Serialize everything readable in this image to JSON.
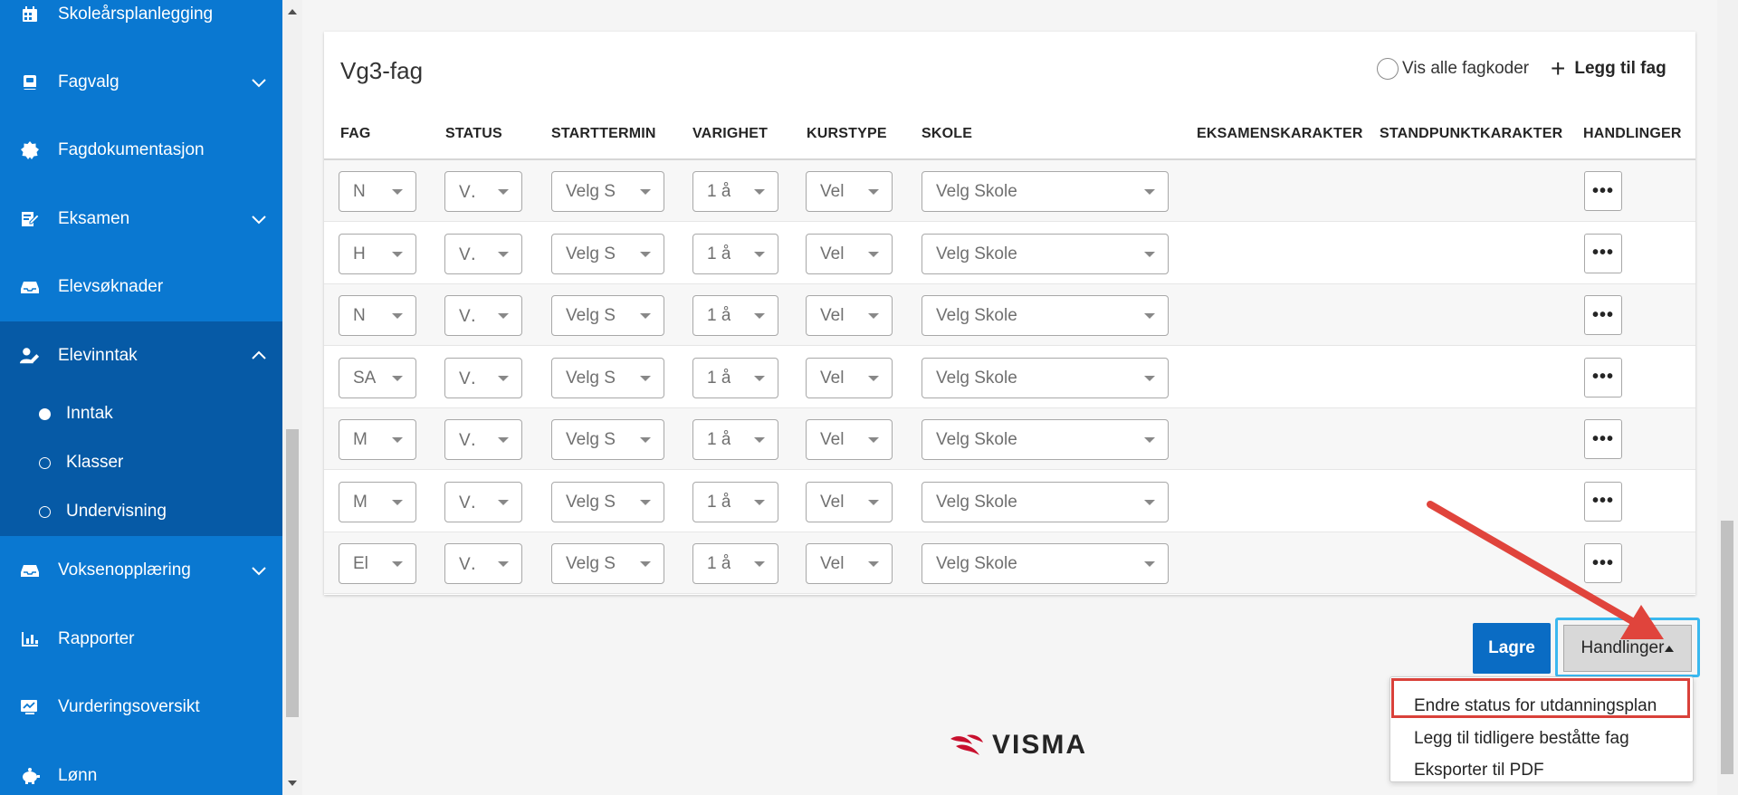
{
  "sidebar": {
    "items": [
      {
        "label": "Skoleårsplanlegging",
        "icon": "calendar-icon"
      },
      {
        "label": "Fagvalg",
        "icon": "book-icon"
      },
      {
        "label": "Fagdokumentasjon",
        "icon": "seal-icon"
      },
      {
        "label": "Eksamen",
        "icon": "edit-doc-icon"
      },
      {
        "label": "Elevsøknader",
        "icon": "inbox-icon"
      },
      {
        "label": "Elevinntak",
        "icon": "user-edit-icon"
      },
      {
        "label": "Voksenopplæring",
        "icon": "inbox-icon"
      },
      {
        "label": "Rapporter",
        "icon": "bar-chart-icon"
      },
      {
        "label": "Vurderingsoversikt",
        "icon": "chart-doc-icon"
      },
      {
        "label": "Lønn",
        "icon": "piggy-bank-icon"
      }
    ],
    "subitems": [
      {
        "label": "Inntak"
      },
      {
        "label": "Klasser"
      },
      {
        "label": "Undervisning"
      }
    ]
  },
  "card": {
    "title": "Vg3-fag",
    "show_codes_label": "Vis alle fagkoder",
    "add_subject_label": "Legg til fag",
    "columns": [
      "FAG",
      "STATUS",
      "STARTTERMIN",
      "VARIGHET",
      "KURSTYPE",
      "SKOLE",
      "EKSAMENSKARAKTER",
      "STANDPUNKTKARAKTER",
      "HANDLINGER"
    ],
    "rows": [
      {
        "fag": "N",
        "status": "V․",
        "start": "Velg S",
        "varighet": "1 å",
        "kurstype": "Vel",
        "skole": "Velg Skole"
      },
      {
        "fag": "H",
        "status": "V․",
        "start": "Velg S",
        "varighet": "1 å",
        "kurstype": "Vel",
        "skole": "Velg Skole"
      },
      {
        "fag": "N",
        "status": "V․",
        "start": "Velg S",
        "varighet": "1 å",
        "kurstype": "Vel",
        "skole": "Velg Skole"
      },
      {
        "fag": "SA",
        "status": "V․",
        "start": "Velg S",
        "varighet": "1 å",
        "kurstype": "Vel",
        "skole": "Velg Skole"
      },
      {
        "fag": "M",
        "status": "V․",
        "start": "Velg S",
        "varighet": "1 å",
        "kurstype": "Vel",
        "skole": "Velg Skole"
      },
      {
        "fag": "M",
        "status": "V․",
        "start": "Velg S",
        "varighet": "1 å",
        "kurstype": "Vel",
        "skole": "Velg Skole"
      },
      {
        "fag": "El",
        "status": "V․",
        "start": "Velg S",
        "varighet": "1 å",
        "kurstype": "Vel",
        "skole": "Velg Skole"
      }
    ],
    "row_action_label": "•••"
  },
  "actions": {
    "save_label": "Lagre",
    "handlinger_label": "Handlinger",
    "menu": [
      "Endre status for utdanningsplan",
      "Legg til tidligere beståtte fag",
      "Eksporter til PDF"
    ]
  },
  "logo": {
    "word": "VISMA"
  },
  "colors": {
    "sidebar": "#0a78d1",
    "sidebar_active": "#065aa6",
    "primary_button": "#0a6cc4",
    "highlight_red": "#d9413a",
    "focus_ring": "#3ab8ef",
    "logo_red": "#c8102e"
  }
}
